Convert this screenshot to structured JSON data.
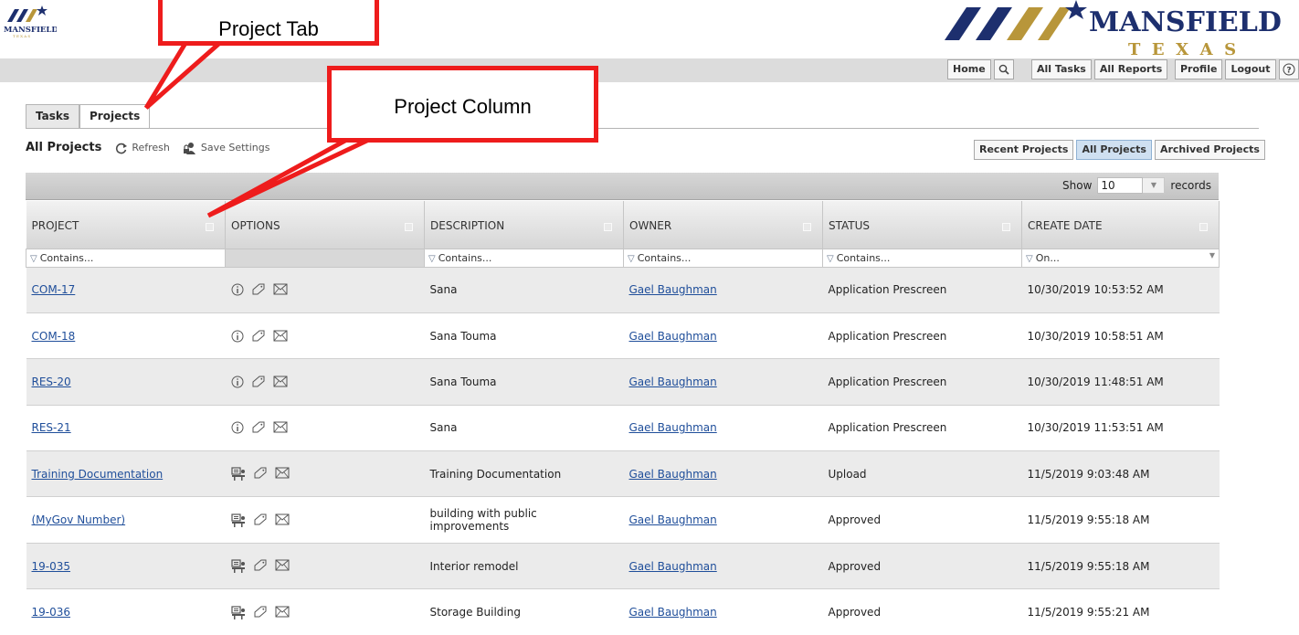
{
  "brand": {
    "small_logo": "MANSFIELD",
    "small_sub": "T E X A S",
    "big_logo": "MANSFIELD",
    "big_sub": "T  E  X  A  S"
  },
  "topnav": {
    "home": "Home",
    "all_tasks": "All Tasks",
    "all_reports": "All Reports",
    "profile": "Profile",
    "logout": "Logout"
  },
  "tabs": [
    "Tasks",
    "Projects"
  ],
  "toolbar": {
    "title": "All Projects",
    "refresh": "Refresh",
    "save_settings": "Save Settings"
  },
  "scope_buttons": [
    "Recent Projects",
    "All Projects",
    "Archived Projects"
  ],
  "paging": {
    "show_label": "Show",
    "show_value": "10",
    "records_label": "records"
  },
  "columns": [
    "PROJECT",
    "OPTIONS",
    "DESCRIPTION",
    "OWNER",
    "STATUS",
    "CREATE DATE"
  ],
  "filters": {
    "project": "Contains...",
    "description": "Contains...",
    "owner": "Contains...",
    "status": "Contains...",
    "create_date": "On..."
  },
  "rows": [
    {
      "project": "COM-17",
      "icon": "info",
      "description": "Sana",
      "owner": "Gael Baughman",
      "status": "Application Prescreen",
      "date": "10/30/2019 10:53:52 AM"
    },
    {
      "project": "COM-18",
      "icon": "info",
      "description": "Sana Touma",
      "owner": "Gael Baughman",
      "status": "Application Prescreen",
      "date": "10/30/2019 10:58:51 AM"
    },
    {
      "project": "RES-20",
      "icon": "info",
      "description": "Sana Touma",
      "owner": "Gael Baughman",
      "status": "Application Prescreen",
      "date": "10/30/2019 11:48:51 AM"
    },
    {
      "project": "RES-21",
      "icon": "info",
      "description": "Sana",
      "owner": "Gael Baughman",
      "status": "Application Prescreen",
      "date": "10/30/2019 11:53:51 AM"
    },
    {
      "project": "Training Documentation",
      "icon": "desk",
      "description": "Training Documentation",
      "owner": "Gael Baughman",
      "status": "Upload",
      "date": "11/5/2019 9:03:48 AM"
    },
    {
      "project": "(MyGov Number)",
      "icon": "desk",
      "description": "building with public improvements",
      "owner": "Gael Baughman",
      "status": "Approved",
      "date": "11/5/2019 9:55:18 AM"
    },
    {
      "project": "19-035",
      "icon": "desk",
      "description": "Interior remodel",
      "owner": "Gael Baughman",
      "status": "Approved",
      "date": "11/5/2019 9:55:18 AM"
    },
    {
      "project": "19-036",
      "icon": "desk",
      "description": "Storage Building",
      "owner": "Gael Baughman",
      "status": "Approved",
      "date": "11/5/2019 9:55:21 AM"
    }
  ],
  "callouts": {
    "project_tab": "Project Tab",
    "project_column": "Project Column"
  },
  "colors": {
    "callout": "#ee1c1c",
    "brand_navy": "#1d2f6e",
    "brand_gold": "#b8963a",
    "link": "#1f4e9a"
  }
}
